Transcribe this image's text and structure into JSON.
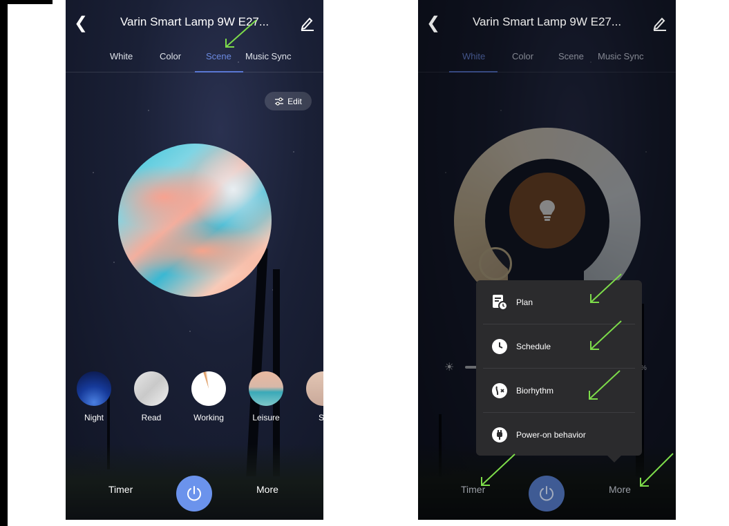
{
  "left_screen": {
    "title": "Varin Smart Lamp 9W E27...",
    "tabs": [
      "White",
      "Color",
      "Scene",
      "Music Sync"
    ],
    "active_tab": "Scene",
    "edit_label": "Edit",
    "scenes": [
      "Night",
      "Read",
      "Working",
      "Leisure",
      "Sc"
    ],
    "timer_label": "Timer",
    "more_label": "More"
  },
  "right_screen": {
    "title": "Varin Smart Lamp 9W E27...",
    "tabs": [
      "White",
      "Color",
      "Scene",
      "Music Sync"
    ],
    "active_tab": "White",
    "brightness_suffix": "%",
    "menu_items": [
      "Plan",
      "Schedule",
      "Biorhythm",
      "Power-on behavior"
    ],
    "timer_label": "Timer",
    "more_label": "More"
  },
  "colors": {
    "accent": "#6b93ec",
    "annotation_arrow": "#7ddc4a",
    "menu_bg": "#2b2b2d"
  }
}
